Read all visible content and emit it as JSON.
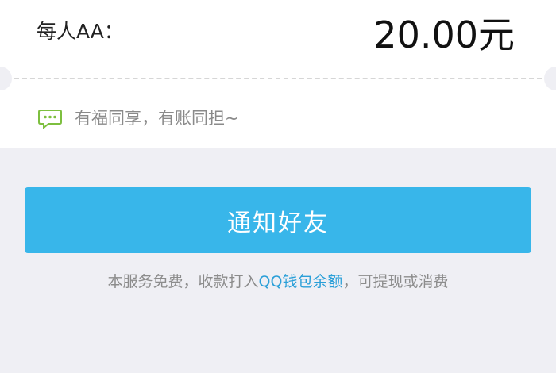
{
  "summary": {
    "per_person_label": "每人AA：",
    "per_person_amount": "20.00元"
  },
  "message": {
    "icon": "chat-bubble-icon",
    "text": "有福同享，有账同担~",
    "icon_color": "#7dbf3f"
  },
  "actions": {
    "notify_label": "通知好友",
    "notify_color": "#38b6ea"
  },
  "footer": {
    "prefix": "本服务免费，收款打入",
    "link": "QQ钱包余额",
    "suffix": "，可提现或消费",
    "link_color": "#2a9fd8"
  }
}
